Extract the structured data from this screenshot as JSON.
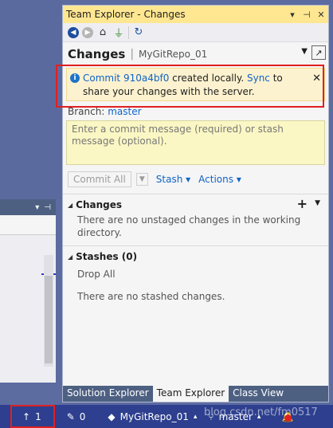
{
  "window": {
    "title": "Team Explorer - Changes"
  },
  "toolbar": {
    "icons": [
      "back-icon",
      "forward-icon",
      "home-icon",
      "connect-icon",
      "refresh-icon"
    ]
  },
  "header": {
    "title": "Changes",
    "repo": "MyGitRepo_01"
  },
  "notice": {
    "commit_link": "Commit 910a4bf0",
    "text_mid": " created locally. ",
    "sync_link": "Sync",
    "text_end": " to share your changes with the server.",
    "close": "✕"
  },
  "branch": {
    "label": "Branch:",
    "value": "master"
  },
  "commit": {
    "placeholder": "Enter a commit message (required) or stash message (optional)."
  },
  "actions": {
    "commit_all": "Commit All",
    "stash": "Stash",
    "actions": "Actions"
  },
  "changes_section": {
    "title": "Changes",
    "message": "There are no unstaged changes in the working directory."
  },
  "stashes_section": {
    "title": "Stashes (0)",
    "drop_all": "Drop All",
    "message": "There are no stashed changes."
  },
  "tabs": [
    {
      "label": "Solution Explorer"
    },
    {
      "label": "Team Explorer"
    },
    {
      "label": "Class View"
    }
  ],
  "status": {
    "push_count": "1",
    "pending_count": "0",
    "repo": "MyGitRepo_01",
    "branch": "master"
  },
  "watermark": "blog.csdn.net/fm0517"
}
